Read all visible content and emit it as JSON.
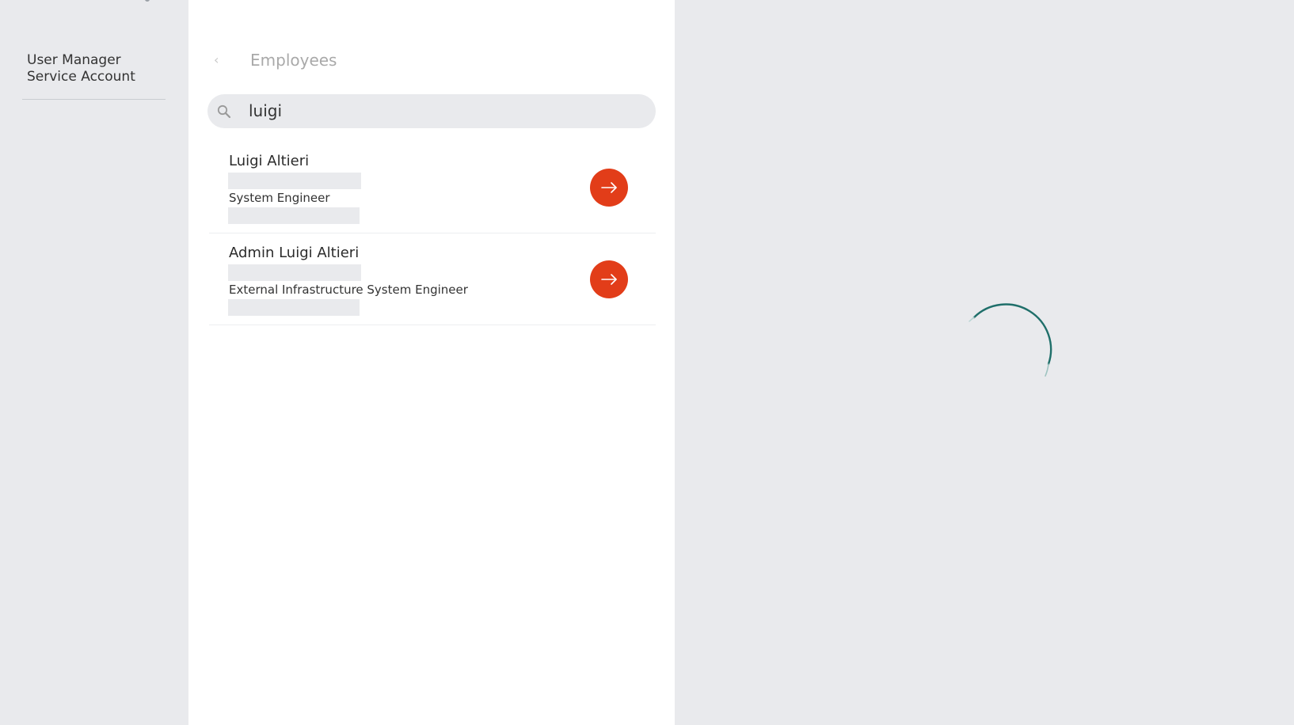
{
  "sidebar": {
    "account_line1": "User Manager",
    "account_line2": "Service Account"
  },
  "panel": {
    "title": "Employees",
    "back_icon": "chevron-left-icon"
  },
  "search": {
    "value": "luigi",
    "icon": "search-icon"
  },
  "results": [
    {
      "name": "Luigi Altieri",
      "role": "System Engineer"
    },
    {
      "name": "Admin Luigi Altieri",
      "role": "External Infrastructure System Engineer"
    }
  ],
  "colors": {
    "accent_button": "#e23d19",
    "spinner": "#1f6f6a",
    "background": "#e9eaed",
    "panel": "#ffffff"
  },
  "detail": {
    "state": "loading"
  }
}
